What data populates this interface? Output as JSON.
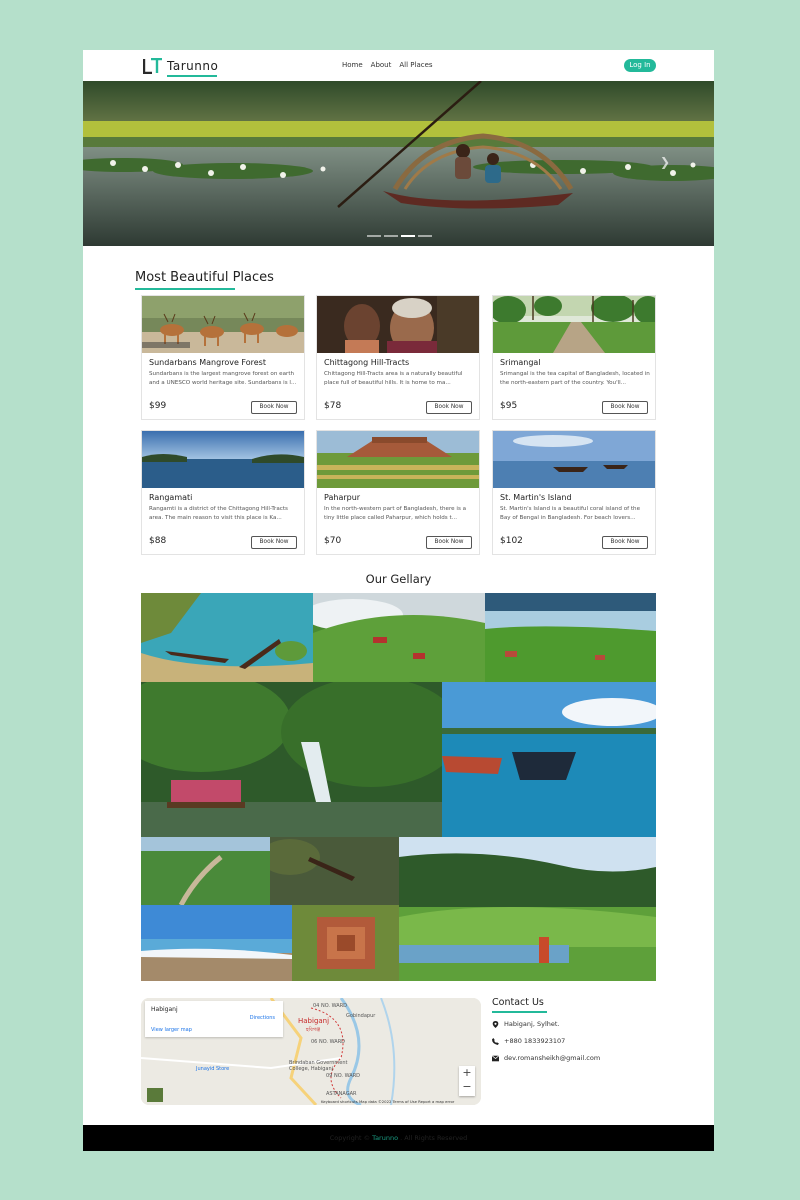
{
  "nav": {
    "logo_text": "Tarunno",
    "links": [
      "Home",
      "About",
      "All Places"
    ],
    "login_label": "Log In"
  },
  "hero": {
    "slide_count": 4,
    "active_slide": 3
  },
  "places_section": {
    "title": "Most Beautiful Places",
    "cards": [
      {
        "name": "Sundarbans Mangrove Forest",
        "desc": "Sundarbans is the largest mangrove forest on earth and a UNESCO world heritage site. Sundarbans is l...",
        "price": "$99",
        "button": "Book Now"
      },
      {
        "name": "Chittagong Hill-Tracts",
        "desc": "Chittagong Hill-Tracts area is a naturally beautiful place full of beautiful hills. It is home to ma...",
        "price": "$78",
        "button": "Book Now"
      },
      {
        "name": "Srimangal",
        "desc": "Srimangal is the tea capital of Bangladesh, located in the north-eastern part of the country. You'll...",
        "price": "$95",
        "button": "Book Now"
      },
      {
        "name": "Rangamati",
        "desc": "Rangamti is a district of the Chittagong Hill-Tracts area. The main reason to visit this place is Ka...",
        "price": "$88",
        "button": "Book Now"
      },
      {
        "name": "Paharpur",
        "desc": "In the north-western part of Bangladesh, there is a tiny little place called Paharpur, which holds t...",
        "price": "$70",
        "button": "Book Now"
      },
      {
        "name": "St. Martin's Island",
        "desc": "St. Martin's Island is a beautiful coral island of the Bay of Bengal in Bangladesh. For beach lovers...",
        "price": "$102",
        "button": "Book Now"
      }
    ]
  },
  "gallery": {
    "title": "Our Gellary"
  },
  "map": {
    "place": "Habiganj",
    "directions": "Directions",
    "larger_map": "View larger map",
    "labels": {
      "ward4": "04 NO. WARD",
      "city": "Habiganj",
      "city_bn": "হবিগঞ্জ",
      "gobindapur": "Gobindapur",
      "ward6": "06 NO. WARD",
      "college": "Brindaban Government College, Habiganj",
      "ward9": "09 NO. WARD",
      "store": "Junayid Store",
      "anagar": "ASTANAGAR"
    },
    "zoom_in": "+",
    "zoom_out": "−",
    "footer": "Keyboard shortcuts   Map data ©2022   Terms of Use   Report a map error"
  },
  "contact": {
    "title": "Contact Us",
    "address": "Habiganj, Sylhet.",
    "phone": "+880 1833923107",
    "email": "dev.romansheikh@gmail.com"
  },
  "footer": {
    "prefix": "Copyright © ",
    "brand": "Tarunno",
    "suffix": " . All Rights Reserved"
  },
  "colors": {
    "accent": "#23b99a",
    "page_bg": "#b5e0cb",
    "footer_bg": "#000000"
  }
}
